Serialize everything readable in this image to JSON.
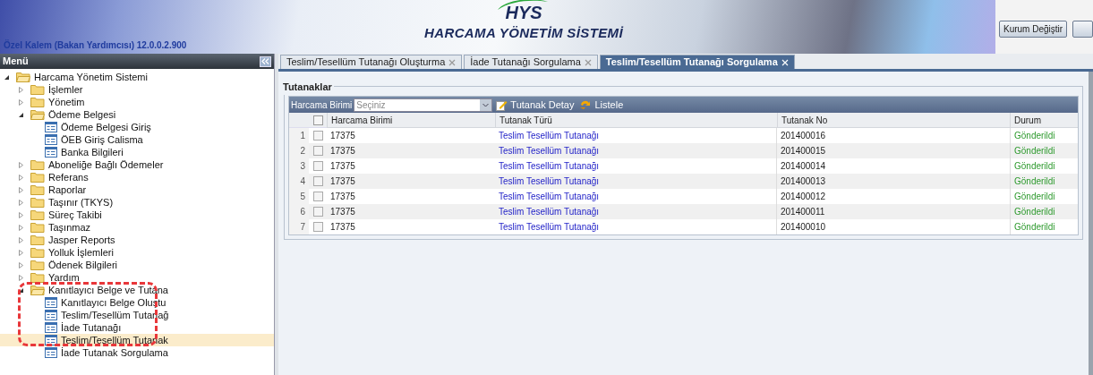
{
  "header": {
    "logo": "HYS",
    "title": "HARCAMA YÖNETİM SİSTEMİ",
    "version": "Özel Kalem (Bakan Yardımcısı) 12.0.0.2.900",
    "buttons": [
      "Kurum Değiştir"
    ]
  },
  "menu": {
    "title": "Menü",
    "tree": [
      {
        "label": "Harcama Yönetim Sistemi",
        "kind": "folder",
        "expanded": true,
        "selected": false,
        "children": [
          {
            "label": "İşlemler",
            "kind": "folder",
            "expanded": false,
            "selected": false
          },
          {
            "label": "Yönetim",
            "kind": "folder",
            "expanded": false,
            "selected": false
          },
          {
            "label": "Ödeme Belgesi",
            "kind": "folder",
            "expanded": true,
            "selected": false,
            "children": [
              {
                "label": "Ödeme Belgesi Giriş",
                "kind": "leaf",
                "selected": false
              },
              {
                "label": "ÖEB Giriş Calisma",
                "kind": "leaf",
                "selected": false
              },
              {
                "label": "Banka Bilgileri",
                "kind": "leaf",
                "selected": false
              }
            ]
          },
          {
            "label": "Aboneliğe Bağlı Ödemeler",
            "kind": "folder",
            "expanded": false,
            "selected": false
          },
          {
            "label": "Referans",
            "kind": "folder",
            "expanded": false,
            "selected": false
          },
          {
            "label": "Raporlar",
            "kind": "folder",
            "expanded": false,
            "selected": false
          },
          {
            "label": "Taşınır (TKYS)",
            "kind": "folder",
            "expanded": false,
            "selected": false
          },
          {
            "label": "Süreç Takibi",
            "kind": "folder",
            "expanded": false,
            "selected": false
          },
          {
            "label": "Taşınmaz",
            "kind": "folder",
            "expanded": false,
            "selected": false
          },
          {
            "label": "Jasper Reports",
            "kind": "folder",
            "expanded": false,
            "selected": false
          },
          {
            "label": "Yolluk İşlemleri",
            "kind": "folder",
            "expanded": false,
            "selected": false
          },
          {
            "label": "Ödenek Bilgileri",
            "kind": "folder",
            "expanded": false,
            "selected": false
          },
          {
            "label": "Yardım",
            "kind": "folder",
            "expanded": false,
            "selected": false
          },
          {
            "label": "Kanıtlayıcı Belge ve Tutana",
            "kind": "folder",
            "expanded": true,
            "selected": false,
            "highlighted": true,
            "children": [
              {
                "label": "Kanıtlayıcı Belge Oluştu",
                "kind": "leaf",
                "selected": false
              },
              {
                "label": "Teslim/Tesellüm Tutanağ",
                "kind": "leaf",
                "selected": false
              },
              {
                "label": "İade Tutanağı",
                "kind": "leaf",
                "selected": false
              },
              {
                "label": "Teslim/Tesellüm Tutanak",
                "kind": "leaf",
                "selected": true
              },
              {
                "label": "İade Tutanak Sorgulama",
                "kind": "leaf",
                "selected": false
              }
            ]
          }
        ]
      }
    ]
  },
  "tabs": [
    {
      "label": "Teslim/Tesellüm Tutanağı Oluşturma",
      "selected": false
    },
    {
      "label": "İade Tutanağı Sorgulama",
      "selected": false
    },
    {
      "label": "Teslim/Tesellüm Tutanağı Sorgulama",
      "selected": true
    }
  ],
  "panel": {
    "legend": "Tutanaklar",
    "toolbar": {
      "filter_label": "Harcama Birimi",
      "filter_placeholder": "Seçiniz",
      "buttons": [
        "Tutanak Detay",
        "Listele"
      ]
    },
    "table": {
      "select_all": false,
      "columns": [
        "Harcama Birimi",
        "Tutanak Türü",
        "Tutanak No",
        "Durum"
      ],
      "rows": [
        {
          "index": "1",
          "checked": false,
          "cells": [
            "17375",
            "Teslim Tesellüm Tutanağı",
            "201400016",
            "Gönderildi"
          ]
        },
        {
          "index": "2",
          "checked": false,
          "cells": [
            "17375",
            "Teslim Tesellüm Tutanağı",
            "201400015",
            "Gönderildi"
          ]
        },
        {
          "index": "3",
          "checked": false,
          "cells": [
            "17375",
            "Teslim Tesellüm Tutanağı",
            "201400014",
            "Gönderildi"
          ]
        },
        {
          "index": "4",
          "checked": false,
          "cells": [
            "17375",
            "Teslim Tesellüm Tutanağı",
            "201400013",
            "Gönderildi"
          ]
        },
        {
          "index": "5",
          "checked": false,
          "cells": [
            "17375",
            "Teslim Tesellüm Tutanağı",
            "201400012",
            "Gönderildi"
          ]
        },
        {
          "index": "6",
          "checked": false,
          "cells": [
            "17375",
            "Teslim Tesellüm Tutanağı",
            "201400011",
            "Gönderildi"
          ]
        },
        {
          "index": "7",
          "checked": false,
          "cells": [
            "17375",
            "Teslim Tesellüm Tutanağı",
            "201400010",
            "Gönderildi"
          ]
        }
      ]
    }
  }
}
